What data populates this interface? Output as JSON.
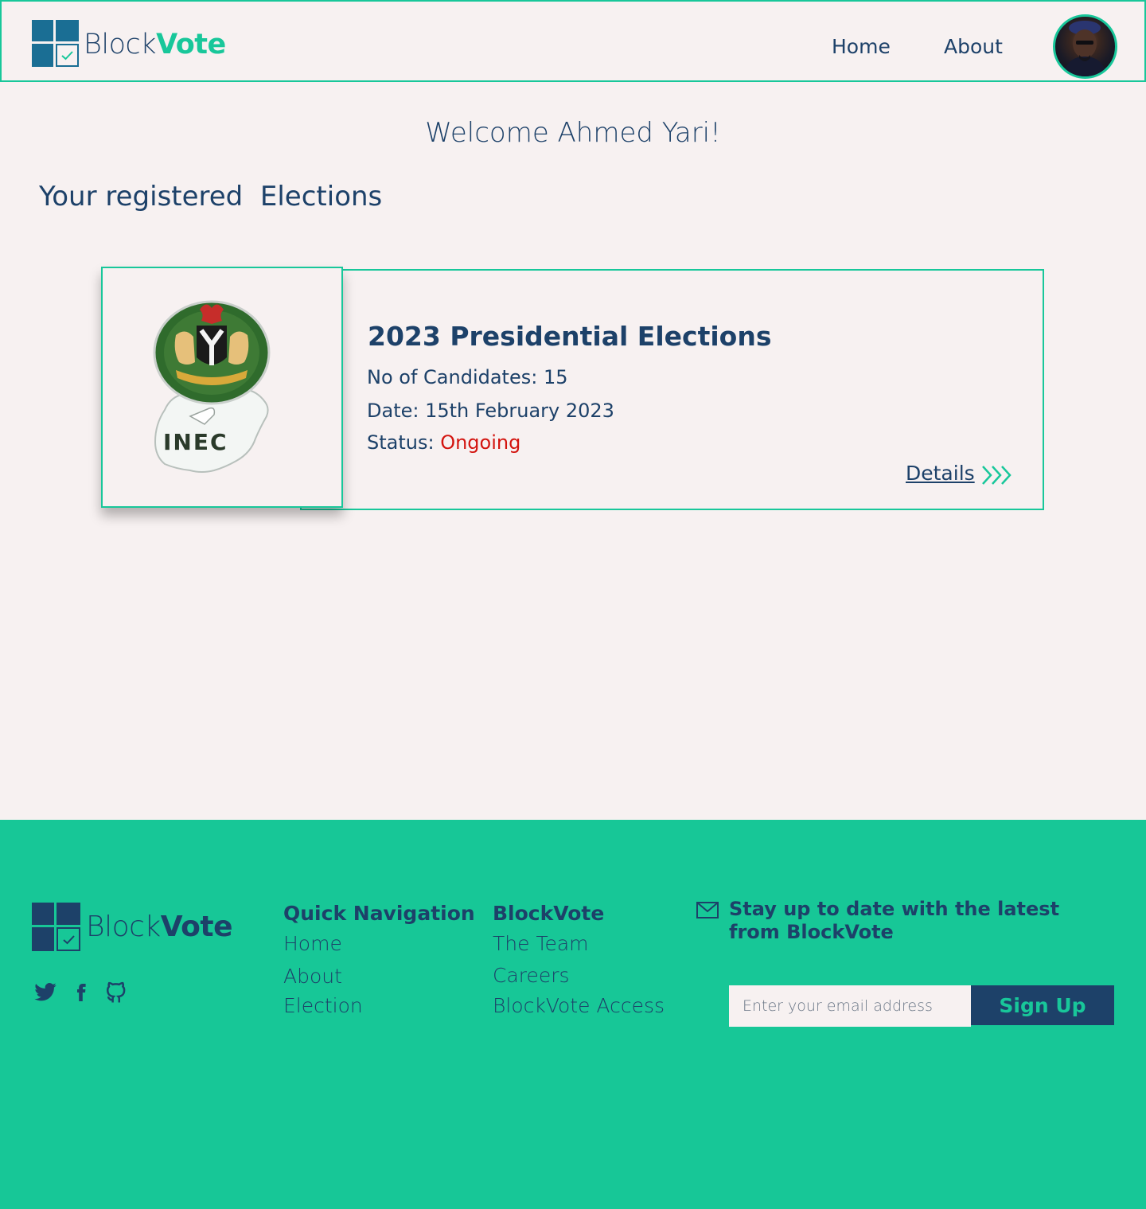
{
  "brand": {
    "name_part1": "Block",
    "name_part2": "Vote"
  },
  "header": {
    "nav": [
      {
        "label": "Home"
      },
      {
        "label": "About"
      }
    ]
  },
  "main": {
    "welcome": "Welcome Ahmed Yari!",
    "section_title": "Your registered  Elections",
    "election": {
      "logo_text": "INEC",
      "title": "2023 Presidential Elections",
      "candidates_label": "No of Candidates: ",
      "candidates_value": "15",
      "date_label": "Date: ",
      "date_value": "15th February 2023",
      "status_label": "Status: ",
      "status_value": "Ongoing",
      "details_label": "Details"
    }
  },
  "footer": {
    "quick_nav": {
      "heading": "Quick Navigation",
      "links": [
        "Home",
        "About",
        "Election"
      ]
    },
    "company": {
      "heading": "BlockVote",
      "links": [
        "The Team",
        "Careers",
        "BlockVote Access"
      ]
    },
    "newsletter": {
      "text": "Stay up to date with the latest from BlockVote",
      "placeholder": "Enter your email address",
      "button": "Sign Up"
    },
    "social_icons": [
      "twitter-icon",
      "facebook-icon",
      "github-icon"
    ]
  },
  "colors": {
    "accent": "#18c79a",
    "navy": "#1d4169",
    "logo_blue": "#1a6e94",
    "status_red": "#d3140f",
    "background": "#f7f1f1",
    "footer_bg": "#17c797"
  }
}
